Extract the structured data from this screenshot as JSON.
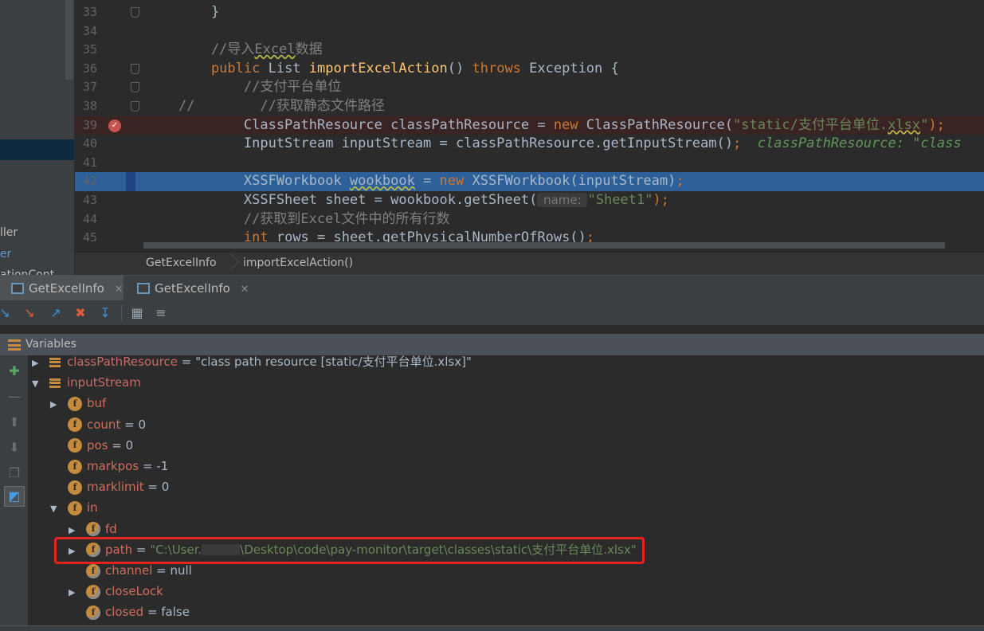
{
  "project_tree": {
    "items": [
      "ller",
      "er",
      "ationCont"
    ]
  },
  "editor": {
    "lines": [
      {
        "num": "33",
        "code": [
          {
            "t": "    }",
            "c": ""
          }
        ]
      },
      {
        "num": "34",
        "code": []
      },
      {
        "num": "35",
        "code": [
          {
            "t": "    //导入",
            "c": "cm"
          },
          {
            "t": "Excel",
            "c": "cm squig"
          },
          {
            "t": "数据",
            "c": "cm"
          }
        ]
      },
      {
        "num": "36",
        "code": [
          {
            "t": "    public ",
            "c": "kw"
          },
          {
            "t": "List ",
            "c": ""
          },
          {
            "t": "importExcelAction",
            "c": "fn"
          },
          {
            "t": "() ",
            "c": ""
          },
          {
            "t": "throws ",
            "c": "kw"
          },
          {
            "t": "Exception {",
            "c": ""
          }
        ]
      },
      {
        "num": "37",
        "code": [
          {
            "t": "        //支付平台单位",
            "c": "cm"
          }
        ]
      },
      {
        "num": "38",
        "code": [
          {
            "t": "//        //获取静态文件路径",
            "c": "cm"
          }
        ]
      },
      {
        "num": "39",
        "code": [
          {
            "t": "        ClassPathResource classPathResource = ",
            "c": ""
          },
          {
            "t": "new ",
            "c": "kw"
          },
          {
            "t": "ClassPathResource(",
            "c": ""
          },
          {
            "t": "\"static/支付平台单位.",
            "c": "st"
          },
          {
            "t": "xlsx",
            "c": "st squig"
          },
          {
            "t": "\"",
            "c": "st"
          },
          {
            "t": ");",
            "c": "kw"
          }
        ]
      },
      {
        "num": "40",
        "code": [
          {
            "t": "        InputStream inputStream = classPathResource.getInputStream()",
            "c": ""
          },
          {
            "t": ";  ",
            "c": "kw"
          },
          {
            "t": "classPathResource: \"class",
            "c": "hint"
          }
        ]
      },
      {
        "num": "41",
        "code": []
      },
      {
        "num": "42",
        "code": [
          {
            "t": "        XSSFWorkbook ",
            "c": ""
          },
          {
            "t": "wookbook",
            "c": "squig"
          },
          {
            "t": " = ",
            "c": ""
          },
          {
            "t": "new ",
            "c": "kw"
          },
          {
            "t": "XSSFWorkbook(inputStream)",
            "c": ""
          },
          {
            "t": ";",
            "c": "kw"
          }
        ]
      },
      {
        "num": "43",
        "code": [
          {
            "t": "        XSSFSheet sheet = wookbook.getSheet(",
            "c": ""
          },
          {
            "t": " name: ",
            "c": "param-hint"
          },
          {
            "t": "\"Sheet1\"",
            "c": "st"
          },
          {
            "t": ");",
            "c": "kw"
          }
        ]
      },
      {
        "num": "44",
        "code": [
          {
            "t": "        //获取到",
            "c": "cm"
          },
          {
            "t": "Excel",
            "c": "cm"
          },
          {
            "t": "文件中的所有行数",
            "c": "cm"
          }
        ]
      },
      {
        "num": "45",
        "code": [
          {
            "t": "        ",
            "c": ""
          },
          {
            "t": "int ",
            "c": "kw"
          },
          {
            "t": "rows = sheet.getPhysicalNumberOfRows()",
            "c": ""
          },
          {
            "t": ";",
            "c": "kw"
          }
        ]
      }
    ],
    "breakpoint_line": "39",
    "current_line": "42"
  },
  "breadcrumb": {
    "class_name": "GetExcelInfo",
    "method_name": "importExcelAction()"
  },
  "debug_tabs": [
    {
      "label": "GetExcelInfo",
      "active": true
    },
    {
      "label": "GetExcelInfo",
      "active": false
    }
  ],
  "toolbar_icons": [
    "step-over-icon",
    "step-into-icon",
    "step-out-icon",
    "drop-frame-icon",
    "run-to-cursor-icon",
    "evaluate-icon",
    "trace-icon"
  ],
  "variables_panel": {
    "title": "Variables",
    "rows": [
      {
        "level": 0,
        "expander": "▶",
        "icon": "obj",
        "name": "classPathResource",
        "sep": " = ",
        "value": "\"class path resource [static/支付平台单位.xlsx]\"",
        "vclass": "vval",
        "name_class": "vname-red"
      },
      {
        "level": 0,
        "expander": "▼",
        "icon": "obj",
        "name": "inputStream",
        "sep": "",
        "value": "",
        "vclass": "vval",
        "name_class": "vname-red"
      },
      {
        "level": 1,
        "expander": "▶",
        "icon": "field",
        "name": "buf",
        "sep": "",
        "value": "",
        "vclass": "vval",
        "name_class": "vname"
      },
      {
        "level": 1,
        "expander": "",
        "icon": "field",
        "name": "count",
        "sep": " = ",
        "value": "0",
        "vclass": "vval",
        "name_class": "vname"
      },
      {
        "level": 1,
        "expander": "",
        "icon": "field",
        "name": "pos",
        "sep": " = ",
        "value": "0",
        "vclass": "vval",
        "name_class": "vname"
      },
      {
        "level": 1,
        "expander": "",
        "icon": "field",
        "name": "markpos",
        "sep": " = ",
        "value": "-1",
        "vclass": "vval",
        "name_class": "vname"
      },
      {
        "level": 1,
        "expander": "",
        "icon": "field",
        "name": "marklimit",
        "sep": " = ",
        "value": "0",
        "vclass": "vval",
        "name_class": "vname"
      },
      {
        "level": 1,
        "expander": "▼",
        "icon": "field",
        "name": "in",
        "sep": "",
        "value": "",
        "vclass": "vval",
        "name_class": "vname"
      },
      {
        "level": 2,
        "expander": "▶",
        "icon": "field-locked",
        "name": "fd",
        "sep": "",
        "value": "",
        "vclass": "vval",
        "name_class": "vname"
      },
      {
        "level": 2,
        "expander": "▶",
        "icon": "field-locked",
        "name": "path",
        "sep": " = ",
        "value_prefix": "\"C:\\User.",
        "value": "\\Desktop\\code\\pay-monitor\\target\\classes\\static\\支付平台单位.xlsx\"",
        "vclass": "vstr",
        "name_class": "vname",
        "redacted": true
      },
      {
        "level": 2,
        "expander": "",
        "icon": "field-locked",
        "name": "channel",
        "sep": " = ",
        "value": "null",
        "vclass": "vval",
        "name_class": "vname"
      },
      {
        "level": 2,
        "expander": "▶",
        "icon": "field-locked",
        "name": "closeLock",
        "sep": "",
        "value": "",
        "vclass": "vval",
        "name_class": "vname"
      },
      {
        "level": 2,
        "expander": "",
        "icon": "field-locked",
        "name": "closed",
        "sep": " = ",
        "value": "false",
        "vclass": "vval",
        "name_class": "vname"
      }
    ]
  },
  "side_icons": [
    "add-watch-icon",
    "remove-watch-icon",
    "move-up-icon",
    "move-down-icon",
    "copy-icon",
    "show-watches-icon"
  ],
  "colors": {
    "accent_selection": "#2d6099",
    "breakpoint": "#c75450",
    "highlight_box": "#e8231d"
  }
}
